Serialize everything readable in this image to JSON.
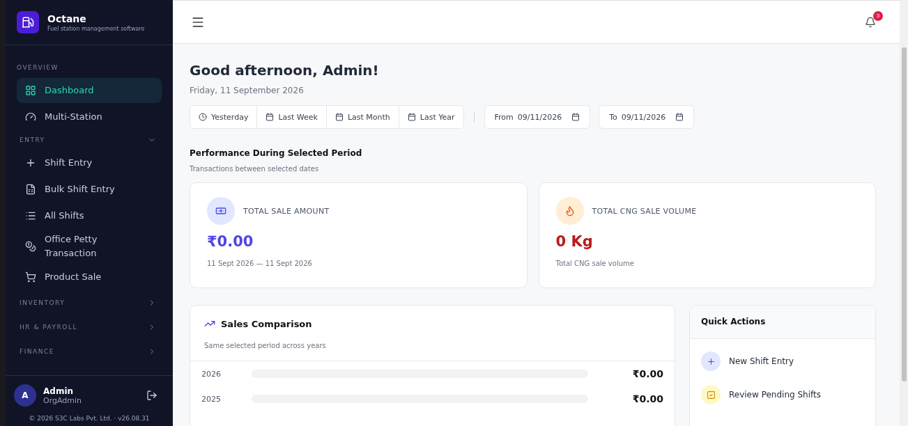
{
  "brand": {
    "name": "Octane",
    "tagline": "Fuel station management software"
  },
  "sidebar": {
    "sections": [
      {
        "label": "OVERVIEW",
        "items": [
          {
            "label": "Dashboard",
            "selected": true
          },
          {
            "label": "Multi-Station",
            "selected": false
          }
        ]
      },
      {
        "label": "ENTRY",
        "expanded": true,
        "items": [
          {
            "label": "Shift Entry",
            "selected": false
          },
          {
            "label": "Bulk Shift Entry",
            "selected": false
          },
          {
            "label": "All Shifts",
            "selected": false
          },
          {
            "label": "Office Petty Transaction",
            "selected": false
          },
          {
            "label": "Product Sale",
            "selected": false
          }
        ]
      },
      {
        "label": "INVENTORY",
        "expanded": false
      },
      {
        "label": "HR & PAYROLL",
        "expanded": false
      },
      {
        "label": "FINANCE",
        "expanded": false
      }
    ]
  },
  "user": {
    "initial": "A",
    "name": "Admin",
    "role": "OrgAdmin"
  },
  "footer": "© 2026 S3C Labs Pvt. Ltd. · v26.08.31",
  "notifications": {
    "count": "3"
  },
  "greeting": "Good afternoon, Admin!",
  "date": "Friday, 11 September 2026",
  "ranges": [
    {
      "label": "Yesterday",
      "selected": false
    },
    {
      "label": "Last Week",
      "selected": false
    },
    {
      "label": "Last Month",
      "selected": false
    },
    {
      "label": "Last Year",
      "selected": false
    }
  ],
  "date_fields": [
    {
      "label": "From",
      "value": "09/11/2026"
    },
    {
      "label": "To",
      "value": "09/11/2026"
    }
  ],
  "performance": {
    "title": "Performance During Selected Period",
    "subtitle": "Transactions between selected dates"
  },
  "stats": [
    {
      "label": "TOTAL SALE AMOUNT",
      "value": "₹0.00",
      "note": "11 Sept 2026 — 11 Sept 2026",
      "color": "#4f46e5"
    },
    {
      "label": "TOTAL CNG SALE VOLUME",
      "value": "0 Kg",
      "note": "Total CNG sale volume",
      "color": "#b91c1c"
    }
  ],
  "comparison": {
    "title": "Sales Comparison",
    "subtitle": "Same selected period across years",
    "rows": [
      {
        "year": "2026",
        "level": 0,
        "amount": "₹0.00"
      },
      {
        "year": "2025",
        "level": 0,
        "amount": "₹0.00"
      }
    ]
  },
  "quick_actions": {
    "title": "Quick Actions",
    "items": [
      {
        "label": "New Shift Entry"
      },
      {
        "label": "Review Pending Shifts"
      }
    ]
  }
}
